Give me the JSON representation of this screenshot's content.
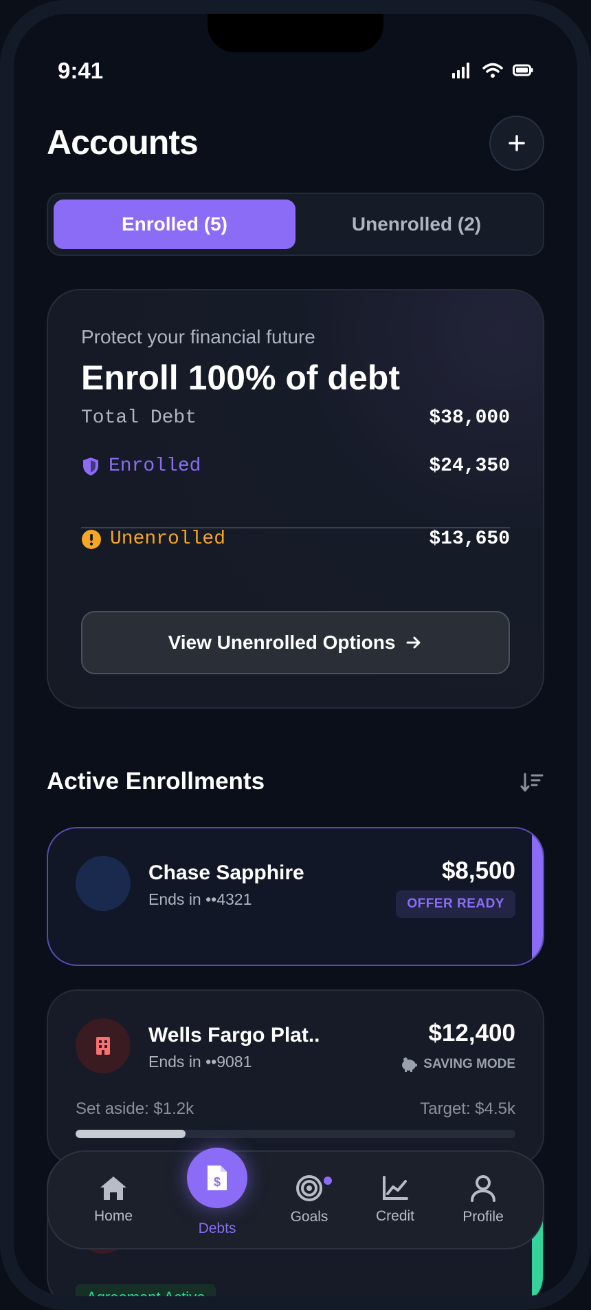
{
  "status_bar": {
    "time": "9:41"
  },
  "header": {
    "title": "Accounts",
    "add_label": "+"
  },
  "segment": {
    "enrolled_label": "Enrolled (5)",
    "unenrolled_label": "Unenrolled (2)"
  },
  "promo": {
    "subtitle": "Protect your financial future",
    "headline": "Enroll 100% of debt",
    "total_label": "Total Debt",
    "total_value": "$38,000",
    "enrolled_label": "Enrolled",
    "enrolled_value": "$24,350",
    "unenrolled_label": "Unenrolled",
    "unenrolled_value": "$13,650",
    "cta_label": "View Unenrolled Options"
  },
  "section": {
    "title": "Active Enrollments"
  },
  "enrollments": [
    {
      "name": "Chase Sapphire",
      "ends": "Ends in ••4321",
      "amount": "$8,500",
      "badge": "OFFER READY"
    },
    {
      "name": "Wells Fargo Plat..",
      "ends": "Ends in ••9081",
      "amount": "$12,400",
      "badge": "SAVING MODE",
      "set_aside": "Set aside: $1.2k",
      "target": "Target: $4.5k",
      "progress": 0.25
    },
    {
      "badge": "Agreement Active"
    }
  ],
  "tabbar": {
    "home": "Home",
    "debts": "Debts",
    "goals": "Goals",
    "credit": "Credit",
    "profile": "Profile"
  },
  "colors": {
    "accent": "#8b6cf6",
    "warning": "#f5a623",
    "success": "#34d399",
    "background": "#0a0f1a"
  }
}
